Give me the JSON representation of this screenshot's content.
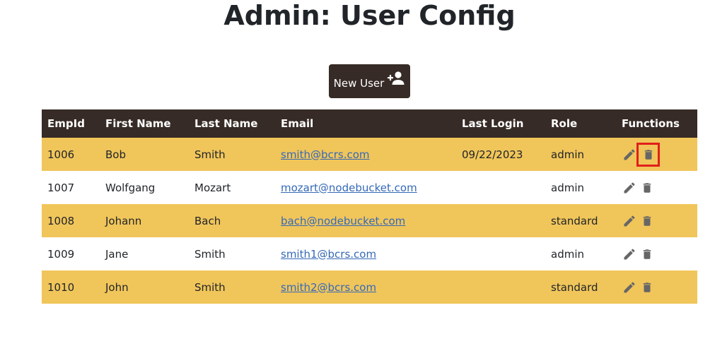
{
  "page": {
    "title": "Admin: User Config"
  },
  "toolbar": {
    "new_user_label": "New User",
    "new_user_icon": "person-add-icon"
  },
  "table": {
    "columns": [
      "EmpId",
      "First Name",
      "Last Name",
      "Email",
      "Last Login",
      "Role",
      "Functions"
    ],
    "rows": [
      {
        "empId": "1006",
        "firstName": "Bob",
        "lastName": "Smith",
        "email": "smith@bcrs.com",
        "lastLogin": "09/22/2023",
        "role": "admin"
      },
      {
        "empId": "1007",
        "firstName": "Wolfgang",
        "lastName": "Mozart",
        "email": "mozart@nodebucket.com",
        "lastLogin": "",
        "role": "admin"
      },
      {
        "empId": "1008",
        "firstName": "Johann",
        "lastName": "Bach",
        "email": "bach@nodebucket.com",
        "lastLogin": "",
        "role": "standard"
      },
      {
        "empId": "1009",
        "firstName": "Jane",
        "lastName": "Smith",
        "email": "smith1@bcrs.com",
        "lastLogin": "",
        "role": "admin"
      },
      {
        "empId": "1010",
        "firstName": "John",
        "lastName": "Smith",
        "email": "smith2@bcrs.com",
        "lastLogin": "",
        "role": "standard"
      }
    ],
    "function_icons": [
      "edit-pencil-icon",
      "delete-trash-icon"
    ],
    "highlighted_delete_row": 0
  },
  "colors": {
    "header_bg": "#362b26",
    "row_alt_bg": "#f0c55a",
    "link": "#3569b8",
    "icon": "#666666",
    "highlight_border": "#e0201b"
  }
}
